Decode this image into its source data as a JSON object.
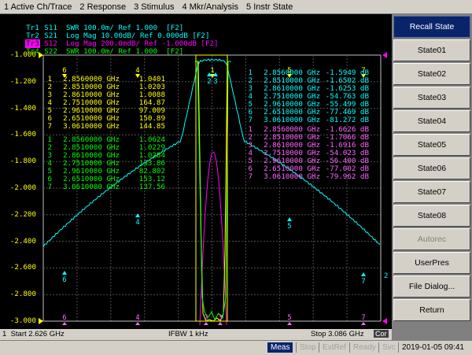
{
  "menu": [
    "1 Active Ch/Trace",
    "2 Response",
    "3 Stimulus",
    "4 Mkr/Analysis",
    "5 Instr State"
  ],
  "traces": [
    {
      "name": "Tr1",
      "text": " S11  SWR 100.0m/ Ref 1.000  [F2]",
      "color": "#00ffff"
    },
    {
      "name": "Tr2",
      "text": " S21  Log Mag 10.00dB/ Ref 0.000dB [F2]",
      "color": "#00ffff"
    },
    {
      "name": "Tr3",
      "text": " S12  Log Mag 200.0mdB/ Ref -1.000dB [F2]",
      "color": "#ff00ff",
      "active": true
    },
    {
      "name": "Tr4",
      "text": " S22  SWR 100.0m/ Ref 1.000  [F2]",
      "color": "#00ff00"
    }
  ],
  "scale_labels": [
    "-1.000",
    "-1.200",
    "-1.400",
    "-1.600",
    "-1.800",
    "-2.000",
    "-2.200",
    "-2.400",
    "-2.600",
    "-2.800",
    "-3.000"
  ],
  "marker_tables": {
    "yellow": [
      [
        "1",
        "2.8560000 GHz",
        "1.0401"
      ],
      [
        "2",
        "2.8510000 GHz",
        "1.0203"
      ],
      [
        "3",
        "2.8610000 GHz",
        "1.0088"
      ],
      [
        "4",
        "2.7510000 GHz",
        "164.87"
      ],
      [
        "5",
        "2.9610000 GHz",
        "97.009"
      ],
      [
        "6",
        "2.6510000 GHz",
        "150.89"
      ],
      [
        "7",
        "3.0610000 GHz",
        "144.85"
      ]
    ],
    "green": [
      [
        "1",
        "2.8560000 GHz",
        "1.0624"
      ],
      [
        "2",
        "2.8510000 GHz",
        "1.0229"
      ],
      [
        "3",
        "2.8610000 GHz",
        "1.0284"
      ],
      [
        "4",
        "2.7510000 GHz",
        "133.86"
      ],
      [
        "5",
        "2.9610000 GHz",
        "82.802"
      ],
      [
        "6",
        "2.6510000 GHz",
        "153.12"
      ],
      [
        "7",
        "3.0610000 GHz",
        "137.56"
      ]
    ],
    "cyan": [
      [
        "1",
        "2.8560000 GHz",
        "-1.5949 dB"
      ],
      [
        "2",
        "2.8510000 GHz",
        "-1.6502 dB"
      ],
      [
        "3",
        "2.8610000 GHz",
        "-1.6253 dB"
      ],
      [
        "4",
        "2.7510000 GHz",
        "-54.763 dB"
      ],
      [
        "5",
        "2.9610000 GHz",
        "-55.499 dB"
      ],
      [
        "6",
        "2.6510000 GHz",
        "-77.469 dB"
      ],
      [
        "7",
        "3.0610000 GHz",
        "-81.272 dB"
      ]
    ],
    "magenta": [
      [
        "1",
        "2.8560000 GHz",
        "-1.6626 dB"
      ],
      [
        "2",
        "2.8510000 GHz",
        "-1.7066 dB"
      ],
      [
        "3",
        "2.8610000 GHz",
        "-1.6916 dB"
      ],
      [
        "4",
        "2.7510000 GHz",
        "-54.023 dB"
      ],
      [
        "5",
        "2.9610000 GHz",
        "-56.400 dB"
      ],
      [
        "6",
        "2.6510000 GHz",
        "-77.002 dB"
      ],
      [
        "7",
        "3.0610000 GHz",
        "-79.962 dB"
      ]
    ]
  },
  "marker_flags": {
    "top": [
      "6",
      "4",
      "1",
      "5",
      "7"
    ],
    "passband": [
      "2",
      "3"
    ],
    "side": [
      "6",
      "4",
      "5",
      "7"
    ],
    "bottom": [
      "6",
      "4",
      "2",
      "3",
      "5",
      "7"
    ],
    "edge": "2"
  },
  "status": {
    "channel": "1",
    "start": "Start 2.626 GHz",
    "ifbw": "IFBW 1 kHz",
    "stop": "Stop 3.086 GHz",
    "cor": "Cor"
  },
  "softkeys": [
    {
      "label": "Recall State",
      "kind": "title"
    },
    {
      "label": "State01"
    },
    {
      "label": "State02"
    },
    {
      "label": "State03"
    },
    {
      "label": "State04"
    },
    {
      "label": "State05"
    },
    {
      "label": "State06"
    },
    {
      "label": "State07"
    },
    {
      "label": "State08"
    },
    {
      "label": "Autorec",
      "kind": "disabled"
    },
    {
      "label": "UserPres"
    },
    {
      "label": "File Dialog..."
    },
    {
      "label": "Return"
    }
  ],
  "bottom": {
    "meas": "Meas",
    "stop": "Stop",
    "extref": "ExtRef",
    "ready": "Ready",
    "svc": "Svc",
    "datetime": "2019-01-05 09:41"
  },
  "colors": {
    "trace_s11": "#00ffff",
    "trace_s21": "#00ffff",
    "trace_s12": "#ff00ff",
    "trace_s22": "#00ff00",
    "marker_table_yellow": "#ffff00",
    "marker_table_green": "#00ff00",
    "marker_table_cyan": "#00ffff",
    "marker_table_magenta": "#ff66ff",
    "grid": "#606060",
    "frame": "#c0c0c0"
  }
}
